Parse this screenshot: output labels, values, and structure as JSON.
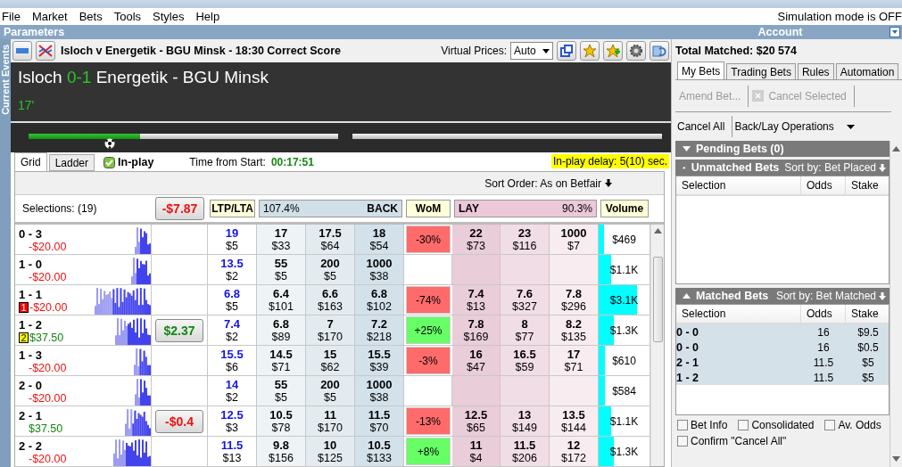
{
  "menu": [
    "File",
    "Market",
    "Bets",
    "Tools",
    "Styles",
    "Help"
  ],
  "simulation_status": "Simulation mode is OFF",
  "panels": {
    "left": "Parameters",
    "right": "Account"
  },
  "side_tab": "Current Events",
  "market": {
    "title": "Isloch v Energetik - BGU Minsk - 18:30 Correct Score",
    "virtual_prices_label": "Virtual Prices:",
    "virtual_prices_value": "Auto"
  },
  "total_matched": "Total Matched: $20 574",
  "event": {
    "home": "Isloch",
    "score": "0-1",
    "away": "Energetik - BGU Minsk",
    "minute": "17'"
  },
  "halves": [
    {
      "level": 0.36
    }
  ],
  "view_tabs": [
    {
      "label": "Grid",
      "selected": true
    },
    {
      "label": "Ladder",
      "selected": false
    }
  ],
  "in_play": {
    "label": "In-play",
    "checked": true
  },
  "time_from_start": {
    "label": "Time from Start:",
    "value": "00:17:51"
  },
  "delay": "In-play delay: 5(10) sec.",
  "sort_order": "Sort Order: As on Betfair",
  "grid_header": {
    "selections": "Selections: (19)",
    "pl": "-$7.87",
    "ltp": "LTP/LTA",
    "back_pct": "107.4%",
    "back": "BACK",
    "wom": "WoM",
    "lay": "LAY",
    "lay_pct": "90.3%",
    "volume": "Volume"
  },
  "rows": [
    {
      "score": "0 - 3",
      "pl": "-$20.00",
      "pl_profit": false,
      "ltp": "19",
      "ltp_amount": "$5",
      "back": [
        {
          "odds": "17",
          "amount": "$33"
        },
        {
          "odds": "17.5",
          "amount": "$64"
        },
        {
          "odds": "18",
          "amount": "$54"
        }
      ],
      "wom": {
        "text": "-30%",
        "positive": false
      },
      "lay": [
        {
          "odds": "22",
          "amount": "$73"
        },
        {
          "odds": "23",
          "amount": "$116"
        },
        {
          "odds": "1000",
          "amount": "$7"
        }
      ],
      "volume": "$469",
      "level": 0.1
    },
    {
      "score": "1 - 0",
      "pl": "-$20.00",
      "pl_profit": false,
      "ltp": "13.5",
      "ltp_amount": "$2",
      "back": [
        {
          "odds": "55",
          "amount": "$5"
        },
        {
          "odds": "200",
          "amount": "$5"
        },
        {
          "odds": "1000",
          "amount": "$38"
        }
      ],
      "volume": "$1.1K",
      "level": 0.25
    },
    {
      "score": "1 - 1",
      "badge": {
        "text": "1",
        "color": "#ff0000"
      },
      "pl": "-$20.00",
      "pl_profit": false,
      "ltp": "6.8",
      "ltp_amount": "$5",
      "back": [
        {
          "odds": "6.4",
          "amount": "$101"
        },
        {
          "odds": "6.6",
          "amount": "$163"
        },
        {
          "odds": "6.8",
          "amount": "$102"
        }
      ],
      "wom": {
        "text": "-74%",
        "positive": false
      },
      "lay": [
        {
          "odds": "7.4",
          "amount": "$13"
        },
        {
          "odds": "7.6",
          "amount": "$327"
        },
        {
          "odds": "7.8",
          "amount": "$296"
        }
      ],
      "volume": "$3.1K",
      "level": 0.75
    },
    {
      "score": "1 - 2",
      "badge": {
        "text": "2",
        "color": "#ffff00"
      },
      "pl": "$37.50",
      "pl_profit": true,
      "button": {
        "text": "$2.37",
        "profit": true
      },
      "ltp": "7.4",
      "ltp_amount": "$2",
      "back": [
        {
          "odds": "6.8",
          "amount": "$89"
        },
        {
          "odds": "7",
          "amount": "$170"
        },
        {
          "odds": "7.2",
          "amount": "$218"
        }
      ],
      "wom": {
        "text": "+25%",
        "positive": true
      },
      "lay": [
        {
          "odds": "7.8",
          "amount": "$169"
        },
        {
          "odds": "8",
          "amount": "$77"
        },
        {
          "odds": "8.2",
          "amount": "$135"
        }
      ],
      "volume": "$1.3K",
      "level": 0.3
    },
    {
      "score": "1 - 3",
      "pl": "-$20.00",
      "pl_profit": false,
      "ltp": "15.5",
      "ltp_amount": "$6",
      "back": [
        {
          "odds": "14.5",
          "amount": "$71"
        },
        {
          "odds": "15",
          "amount": "$62"
        },
        {
          "odds": "15.5",
          "amount": "$39"
        }
      ],
      "wom": {
        "text": "-3%",
        "positive": false
      },
      "lay": [
        {
          "odds": "16",
          "amount": "$47"
        },
        {
          "odds": "16.5",
          "amount": "$59"
        },
        {
          "odds": "17",
          "amount": "$71"
        }
      ],
      "volume": "$610",
      "level": 0.12
    },
    {
      "score": "2 - 0",
      "pl": "-$20.00",
      "pl_profit": false,
      "ltp": "14",
      "ltp_amount": "$2",
      "back": [
        {
          "odds": "55",
          "amount": "$5"
        },
        {
          "odds": "200",
          "amount": "$5"
        },
        {
          "odds": "1000",
          "amount": "$38"
        }
      ],
      "volume": "$584",
      "level": 0.12
    },
    {
      "score": "2 - 1",
      "pl": "$37.50",
      "pl_profit": true,
      "button": {
        "text": "-$0.4",
        "profit": false
      },
      "ltp": "12.5",
      "ltp_amount": "$3",
      "back": [
        {
          "odds": "10.5",
          "amount": "$78"
        },
        {
          "odds": "11",
          "amount": "$170"
        },
        {
          "odds": "11.5",
          "amount": "$70"
        }
      ],
      "wom": {
        "text": "-13%",
        "positive": false
      },
      "lay": [
        {
          "odds": "12.5",
          "amount": "$65"
        },
        {
          "odds": "13",
          "amount": "$149"
        },
        {
          "odds": "13.5",
          "amount": "$144"
        }
      ],
      "volume": "$1.1K",
      "level": 0.25
    },
    {
      "score": "2 - 2",
      "pl": "-$20.00",
      "pl_profit": false,
      "ltp": "11.5",
      "ltp_amount": "$13",
      "back": [
        {
          "odds": "9.8",
          "amount": "$156"
        },
        {
          "odds": "10",
          "amount": "$125"
        },
        {
          "odds": "10.5",
          "amount": "$133"
        }
      ],
      "wom": {
        "text": "+8%",
        "positive": true
      },
      "lay": [
        {
          "odds": "11",
          "amount": "$4"
        },
        {
          "odds": "11.5",
          "amount": "$206"
        },
        {
          "odds": "12",
          "amount": "$172"
        }
      ],
      "volume": "$1.3K",
      "level": 0.3
    }
  ],
  "bet_tabs": [
    {
      "label": "My Bets",
      "selected": true
    },
    {
      "label": "Trading Bets",
      "selected": false
    },
    {
      "label": "Rules",
      "selected": false
    },
    {
      "label": "Automation",
      "selected": false
    }
  ],
  "bet_actions": [
    {
      "label": "Amend Bet...",
      "disabled": true
    },
    {
      "label": "Cancel Selected",
      "disabled": true
    }
  ],
  "cancel_all": "Cancel All",
  "back_lay_menu": "Back/Lay Operations",
  "pending": {
    "title": "Pending Bets (0)",
    "expanded": false
  },
  "unmatched": {
    "title": "Unmatched Bets",
    "sort": "Sort by: Bet Placed",
    "expanded": true,
    "columns": [
      "Selection",
      "Odds",
      "Stake"
    ]
  },
  "matched": {
    "title": "Matched Bets",
    "sort": "Sort by: Bet Matched",
    "expanded": true,
    "columns": [
      "Selection",
      "Odds",
      "Stake"
    ],
    "rows": [
      {
        "selection": "0 - 0",
        "odds": "16",
        "stake": "$9.5"
      },
      {
        "selection": "0 - 0",
        "odds": "16",
        "stake": "$0.5"
      },
      {
        "selection": "2 - 1",
        "odds": "11.5",
        "stake": "$5"
      },
      {
        "selection": "1 - 2",
        "odds": "11.5",
        "stake": "$5"
      }
    ]
  },
  "options": [
    {
      "label": "Bet Info",
      "checked": false
    },
    {
      "label": "Consolidated",
      "checked": false
    },
    {
      "label": "Av. Odds",
      "checked": false
    },
    {
      "label": "Confirm \"Cancel All\"",
      "checked": false
    }
  ]
}
